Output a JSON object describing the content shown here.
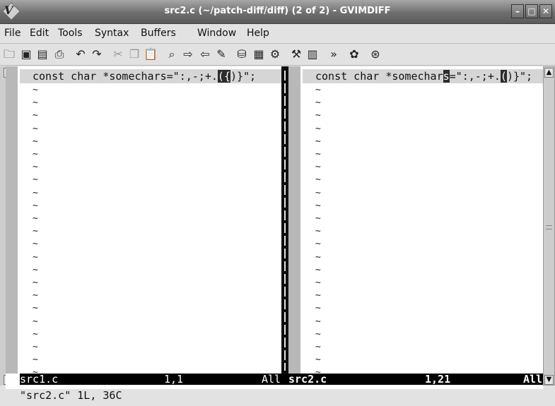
{
  "window": {
    "title": "src2.c (~/patch-diff/diff) (2 of 2) - GVIMDIFF",
    "logo_letter": "V",
    "buttons": {
      "minimize": "–",
      "maximize": "□",
      "close": "✕"
    }
  },
  "menubar": {
    "items": [
      "File",
      "Edit",
      "Tools",
      "Syntax",
      "Buffers",
      "Window",
      "Help"
    ]
  },
  "toolbar": {
    "icons": [
      {
        "name": "open-folder-icon",
        "glyph": "🗀"
      },
      {
        "name": "save-icon",
        "glyph": "▣"
      },
      {
        "name": "save-all-icon",
        "glyph": "▤"
      },
      {
        "name": "print-icon",
        "glyph": "⎙"
      },
      {
        "name": "undo-icon",
        "glyph": "↶"
      },
      {
        "name": "redo-icon",
        "glyph": "↷"
      },
      {
        "name": "cut-icon",
        "glyph": "✂",
        "disabled": true
      },
      {
        "name": "copy-icon",
        "glyph": "❐",
        "disabled": true
      },
      {
        "name": "paste-icon",
        "glyph": "📋"
      },
      {
        "name": "find-icon",
        "glyph": "⌕"
      },
      {
        "name": "find-next-icon",
        "glyph": "⇨"
      },
      {
        "name": "find-prev-icon",
        "glyph": "⇦"
      },
      {
        "name": "load-session-icon",
        "glyph": "✎"
      },
      {
        "name": "save-session-icon",
        "glyph": "⛁"
      },
      {
        "name": "run-script-icon",
        "glyph": "▦"
      },
      {
        "name": "make-icon",
        "glyph": "⚙"
      },
      {
        "name": "run-ctags-icon",
        "glyph": "⚒"
      },
      {
        "name": "tag-jump-icon",
        "glyph": "▥"
      },
      {
        "name": "help-icon",
        "glyph": "»"
      },
      {
        "name": "find-help-icon",
        "glyph": "✿"
      },
      {
        "name": "exit-icon",
        "glyph": "⊛"
      }
    ]
  },
  "editor": {
    "left": {
      "line_before": "const char *somechars=\":,-;+.",
      "line_hl": "(",
      "line_hl2": "{",
      "line_after": ")}\";",
      "tildes": "~\n~\n~\n~\n~\n~\n~\n~\n~\n~\n~\n~\n~\n~\n~\n~\n~\n~\n~\n~\n~\n~\n~",
      "status_file": "src1.c",
      "status_pos": "1,1",
      "status_pct": "All"
    },
    "right": {
      "line_before": "const char *somechar",
      "line_cursor": "s",
      "line_mid": "=\":,-;+.",
      "line_hl": "(",
      "line_after": ")}\";",
      "tildes": "~\n~\n~\n~\n~\n~\n~\n~\n~\n~\n~\n~\n~\n~\n~\n~\n~\n~\n~\n~\n~\n~\n~",
      "status_file": "src2.c",
      "status_pos": "1,21",
      "status_pct": "All"
    },
    "cmdline": "\"src2.c\" 1L, 36C"
  },
  "scrollbar": {
    "up": "▲",
    "down": "▼"
  }
}
